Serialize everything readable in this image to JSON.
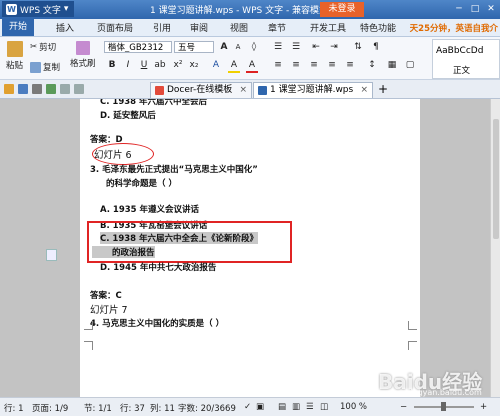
{
  "titlebar": {
    "app_name": "WPS 文字",
    "doc_title": "1 课堂习题讲解.wps - WPS 文字 - 兼容模式",
    "login_label": "未登录",
    "minimize": "─",
    "maximize": "□",
    "close": "✕"
  },
  "menu": {
    "tabs": [
      "开始",
      "插入",
      "页面布局",
      "引用",
      "审阅",
      "视图",
      "章节",
      "开发工具",
      "特色功能"
    ],
    "promo": "天25分钟，英语自我介"
  },
  "ribbon": {
    "paste": "粘贴",
    "cut": "剪切",
    "copy": "复制",
    "format_painter": "格式刷",
    "font_name": "楷体_GB2312",
    "font_size": "五号",
    "bold": "B",
    "italic": "I",
    "underline": "U",
    "style_preview": "AaBbCcDd",
    "style_name": "正文"
  },
  "doc_tabs": [
    {
      "label": "Docer-在线模板"
    },
    {
      "label": "1 课堂习题讲解.wps"
    }
  ],
  "document": {
    "lines": [
      "C. 1938 年六届六中全会后",
      "D. 延安整风后",
      "答案：D",
      "幻灯片 6",
      "3. 毛泽东最先正式提出“马克思主义中国化”",
      "的科学命题是（    ）",
      "A. 1935 年遵义会议讲话",
      "B. 1935 年瓦窑堡会议讲话",
      "C. 1938 年六届六中全会上《论新阶段》",
      "的政治报告",
      "D. 1945 年中共七大政治报告",
      "答案：C",
      "幻灯片 7",
      "4. 马克思主义中国化的实质是（    ）"
    ]
  },
  "status": {
    "row": "行: 1",
    "page": "页面: 1/9",
    "section": "节: 1/1",
    "row_col": "行: 37",
    "col": "列: 11",
    "words": "字数: 20/3669",
    "zoom": "100 %"
  },
  "watermark": {
    "text": "Baidu经验",
    "sub": "jingyan.baidu.com"
  },
  "colors": {
    "accent": "#2f66ad",
    "login": "#e8622a",
    "highlight_box": "#e02424"
  }
}
